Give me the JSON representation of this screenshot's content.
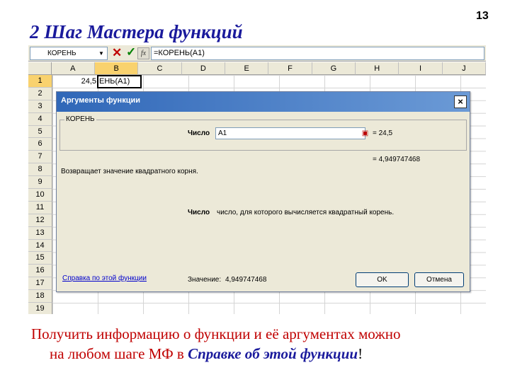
{
  "slide": {
    "title": "2 Шаг Мастера функций",
    "number": "13",
    "caption_line1": "Получить информацию о функции и её аргументах можно",
    "caption_line2_prefix": "на любом шаге МФ в ",
    "caption_line2_emphasis": "Справке об этой функции",
    "caption_line2_suffix": "!"
  },
  "formula_bar": {
    "name_box": "КОРЕНЬ",
    "cancel_icon": "✕",
    "enter_icon": "✓",
    "fx_label": "fx",
    "content": "=КОРЕНЬ(A1)"
  },
  "sheet": {
    "columns": [
      "A",
      "B",
      "C",
      "D",
      "E",
      "F",
      "G",
      "H",
      "I",
      "J"
    ],
    "rows": [
      "1",
      "2",
      "3",
      "4",
      "5",
      "6",
      "7",
      "8",
      "9",
      "10",
      "11",
      "12",
      "13",
      "14",
      "15",
      "16",
      "17",
      "18",
      "19"
    ],
    "cell_a1": "24,5",
    "cell_b1": "ЕНЬ(A1)"
  },
  "dialog": {
    "title": "Аргументы функции",
    "close_label": "×",
    "group_label": "КОРЕНЬ",
    "arg_label": "Число",
    "arg_value": "A1",
    "arg_result": "= 24,5",
    "func_result": "= 4,949747468",
    "description": "Возвращает значение квадратного корня.",
    "arg_desc_label": "Число",
    "arg_desc_text": "число, для которого вычисляется квадратный корень.",
    "help_link": "Справка по этой функции",
    "value_label": "Значение:",
    "value": "4,949747468",
    "ok_label": "OK",
    "cancel_label": "Отмена"
  },
  "colors": {
    "title": "#1a1a9c",
    "caption": "#c00000",
    "dialog_titlebar": "#3067b8",
    "active_header": "#f9d26e"
  }
}
